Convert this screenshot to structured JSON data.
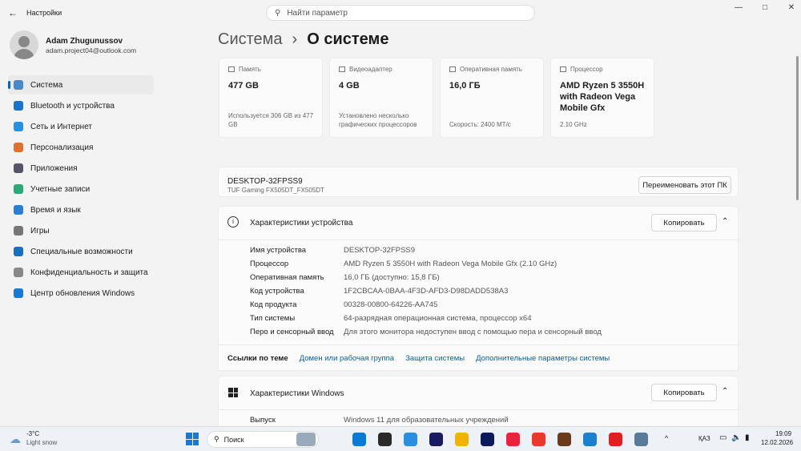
{
  "window": {
    "title": "Настройки",
    "search_placeholder": "Найти параметр",
    "minimize": "—",
    "maximize": "□",
    "close": "✕"
  },
  "user": {
    "name": "Adam Zhugunussov",
    "email": "adam.project04@outlook.com"
  },
  "sidebar": {
    "items": [
      {
        "label": "Система",
        "color": "#4a88c8"
      },
      {
        "label": "Bluetooth и устройства",
        "color": "#1a73c8"
      },
      {
        "label": "Сеть и Интернет",
        "color": "#2b8fe0"
      },
      {
        "label": "Персонализация",
        "color": "#e07030"
      },
      {
        "label": "Приложения",
        "color": "#556"
      },
      {
        "label": "Учетные записи",
        "color": "#2aa876"
      },
      {
        "label": "Время и язык",
        "color": "#2a7fd0"
      },
      {
        "label": "Игры",
        "color": "#777"
      },
      {
        "label": "Специальные возможности",
        "color": "#1a6fc0"
      },
      {
        "label": "Конфиденциальность и защита",
        "color": "#888"
      },
      {
        "label": "Центр обновления Windows",
        "color": "#1a78d0"
      }
    ]
  },
  "breadcrumb": {
    "parent": "Система",
    "sep": "›",
    "current": "О системе"
  },
  "cards": [
    {
      "label": "Память",
      "value": "477 GB",
      "sub": "Используется 306 GB из 477 GB"
    },
    {
      "label": "Видеоадаптер",
      "value": "4 GB",
      "sub": "Установлено несколько графических процессоров"
    },
    {
      "label": "Оперативная память",
      "value": "16,0 ГБ",
      "sub": "Скорость: 2400 МТ/с"
    },
    {
      "label": "Процессор",
      "value": "AMD Ryzen 5 3550H with Radeon Vega Mobile Gfx",
      "sub": "2.10 GHz"
    }
  ],
  "device": {
    "name": "DESKTOP-32FPSS9",
    "model": "TUF Gaming FX505DT_FX505DT",
    "rename": "Переименовать этот ПК"
  },
  "specs": {
    "title": "Характеристики устройства",
    "copy": "Копировать",
    "rows": [
      {
        "k": "Имя устройства",
        "v": "DESKTOP-32FPSS9"
      },
      {
        "k": "Процессор",
        "v": "AMD Ryzen 5 3550H with Radeon Vega Mobile Gfx   (2.10 GHz)"
      },
      {
        "k": "Оперативная память",
        "v": "16,0 ГБ (доступно: 15,8 ГБ)"
      },
      {
        "k": "Код устройства",
        "v": "1F2CBCAA-0BAA-4F3D-AFD3-D98DADD538A3"
      },
      {
        "k": "Код продукта",
        "v": "00328-00800-64226-AA745"
      },
      {
        "k": "Тип системы",
        "v": "64-разрядная операционная система, процессор x64"
      },
      {
        "k": "Перо и сенсорный ввод",
        "v": "Для этого монитора недоступен ввод с помощью пера и сенсорный ввод"
      }
    ]
  },
  "links": {
    "label": "Ссылки по теме",
    "items": [
      "Домен или рабочая группа",
      "Защита системы",
      "Дополнительные параметры системы"
    ]
  },
  "windows": {
    "title": "Характеристики Windows",
    "copy": "Копировать",
    "rows": [
      {
        "k": "Выпуск",
        "v": "Windows 11 для образовательных учреждений"
      }
    ]
  },
  "taskbar": {
    "temp": "-3°C",
    "weather": "Light snow",
    "search": "Поиск",
    "lang": "ҚАЗ",
    "time": "19:09",
    "date": "12.02.2026",
    "apps": [
      "#333",
      "#0a7bd4",
      "#2a2a2a",
      "#2a8fe0",
      "#1a1a60",
      "#f0b400",
      "#0a1a5a",
      "#e8243c",
      "#e83a2a",
      "#6a3a1a",
      "#1a80d0",
      "#e02020",
      "#5a7a9a"
    ]
  }
}
